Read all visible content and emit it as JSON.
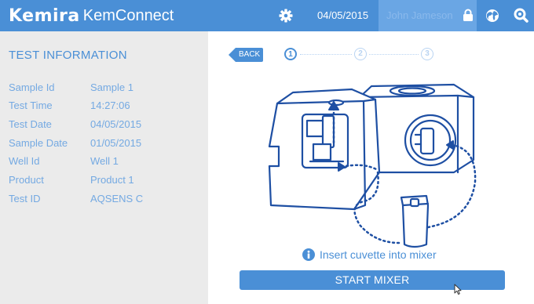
{
  "header": {
    "brand": "Kemira",
    "app_name": "KemConnect",
    "date": "04/05/2015",
    "user_name": "John Jameson"
  },
  "test_info": {
    "title": "TEST INFORMATION",
    "rows": [
      {
        "label": "Sample Id",
        "value": "Sample 1"
      },
      {
        "label": "Test Time",
        "value": "14:27:06"
      },
      {
        "label": "Test Date",
        "value": "04/05/2015"
      },
      {
        "label": "Sample Date",
        "value": "01/05/2015"
      },
      {
        "label": "Well Id",
        "value": "Well 1"
      },
      {
        "label": "Product",
        "value": "Product 1"
      },
      {
        "label": "Test ID",
        "value": "AQSENS C"
      }
    ]
  },
  "wizard": {
    "back_label": "BACK",
    "steps": [
      "1",
      "2",
      "3"
    ],
    "active_step": 1,
    "instruction": "Insert cuvette into mixer",
    "start_button": "START MIXER"
  },
  "icons": {
    "settings": "gear-icon",
    "lock": "lock-icon",
    "globe": "globe-icon",
    "search": "search-icon",
    "info": "info-icon",
    "cursor": "mouse-cursor-icon"
  },
  "colors": {
    "primary": "#4a8fd6",
    "user_bg": "#6aa6e4",
    "panel_bg": "#ebebeb",
    "label_text": "#74a9e2",
    "step_inactive": "#b9d4f2",
    "illustration_line": "#1e4fa3"
  }
}
